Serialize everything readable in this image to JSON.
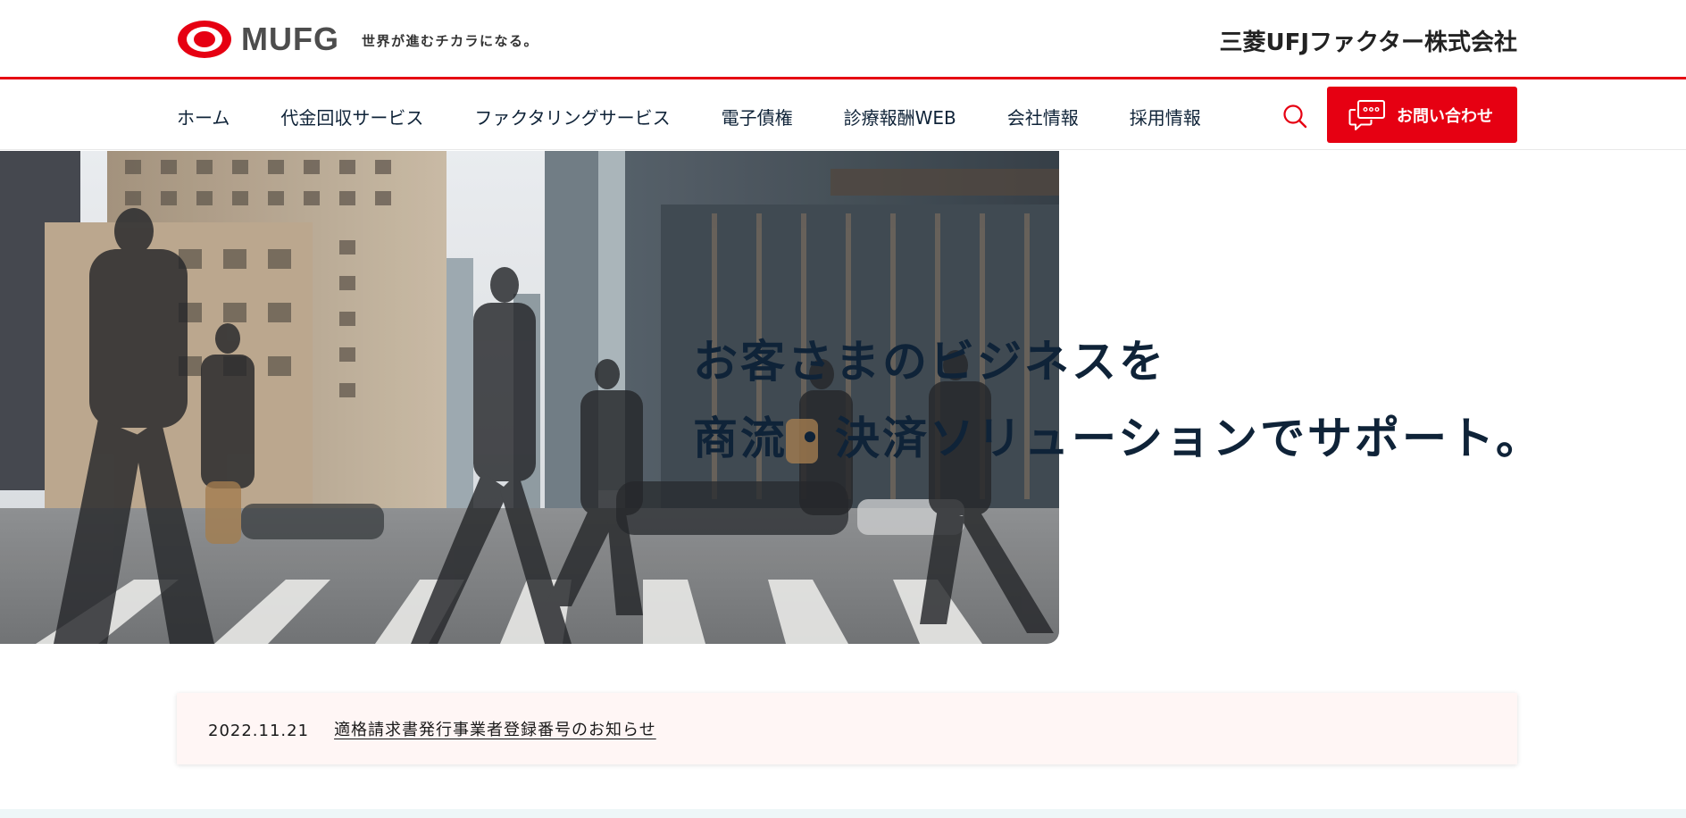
{
  "header": {
    "logo_text": "MUFG",
    "tagline": "世界が進むチカラになる。",
    "company_name": "三菱UFJファクター株式会社",
    "brand_color": "#e60012"
  },
  "nav": {
    "items": [
      {
        "label": "ホーム"
      },
      {
        "label": "代金回収サービス"
      },
      {
        "label": "ファクタリングサービス"
      },
      {
        "label": "電子債権"
      },
      {
        "label": "診療報酬WEB"
      },
      {
        "label": "会社情報"
      },
      {
        "label": "採用情報"
      }
    ],
    "search_icon": "search-icon",
    "contact_label": "お問い合わせ",
    "contact_icon": "chat-bubbles-icon"
  },
  "hero": {
    "line1": "お客さまのビジネスを",
    "line2": "商流・決済ソリューションでサポート。"
  },
  "news": {
    "date": "2022.11.21",
    "title": "適格請求書発行事業者登録番号のお知らせ"
  }
}
